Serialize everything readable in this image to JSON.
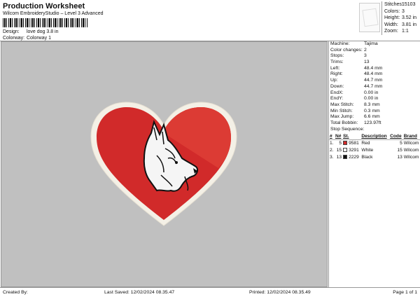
{
  "header": {
    "title": "Production Worksheet",
    "subtitle": "Wilcom EmbroideryStudio – Level 3 Advanced",
    "design_label": "Design:",
    "design_value": "love dog 3.8 in",
    "colorway_label": "Colorway:",
    "colorway_value": "Colorway 1"
  },
  "top_stats": [
    {
      "label": "Stitches:",
      "value": "15103"
    },
    {
      "label": "Colors:",
      "value": "3"
    },
    {
      "label": "Height:",
      "value": "3.52 in"
    },
    {
      "label": "Width:",
      "value": "3.81 in"
    },
    {
      "label": "Zoom:",
      "value": "1:1"
    }
  ],
  "machine_info": [
    {
      "label": "Machine:",
      "value": "Tajima"
    },
    {
      "label": "Color changes:",
      "value": "2"
    },
    {
      "label": "Stops:",
      "value": "3"
    },
    {
      "label": "Trims:",
      "value": "13"
    },
    {
      "label": "Left:",
      "value": "48.4 mm"
    },
    {
      "label": "Right:",
      "value": "48.4 mm"
    },
    {
      "label": "Up:",
      "value": "44.7 mm"
    },
    {
      "label": "Down:",
      "value": "44.7 mm"
    },
    {
      "label": "EndX:",
      "value": "0.00 in"
    },
    {
      "label": "EndY:",
      "value": "0.00 in"
    },
    {
      "label": "Max Stitch:",
      "value": "8.3 mm"
    },
    {
      "label": "Min Stitch:",
      "value": "0.3 mm"
    },
    {
      "label": "Max Jump:",
      "value": "6.6 mm"
    },
    {
      "label": "Total Bobbin:",
      "value": "123.97ft"
    }
  ],
  "stop_sequence": {
    "title": "Stop Sequence:",
    "headers": {
      "num": "#",
      "n": "N#",
      "st": "St.",
      "description": "Description",
      "code": "Code",
      "brand": "Brand"
    },
    "rows": [
      {
        "num": "1.",
        "n": "5",
        "st": "9581",
        "color": "#d12a2a",
        "description": "Red",
        "code": "5",
        "brand": "Wilcom"
      },
      {
        "num": "2.",
        "n": "15",
        "st": "3291",
        "color": "#ffffff",
        "description": "White",
        "code": "15",
        "brand": "Wilcom"
      },
      {
        "num": "3.",
        "n": "13",
        "st": "2229",
        "color": "#111111",
        "description": "Black",
        "code": "13",
        "brand": "Wilcom"
      }
    ]
  },
  "footer": {
    "created_by": "Created By:",
    "last_saved": "Last Saved: 12/02/2024 08.35.47",
    "printed": "Printed: 12/02/2024 08.35.49",
    "page": "Page 1 of 1"
  },
  "colors": {
    "canvas": "#c0c0c0",
    "heart_red": "#d12a2a",
    "heart_red_light": "#dc3b34",
    "heart_border": "#f4f0e6",
    "dog_white": "#f5f5f5",
    "dog_black": "#111111"
  }
}
